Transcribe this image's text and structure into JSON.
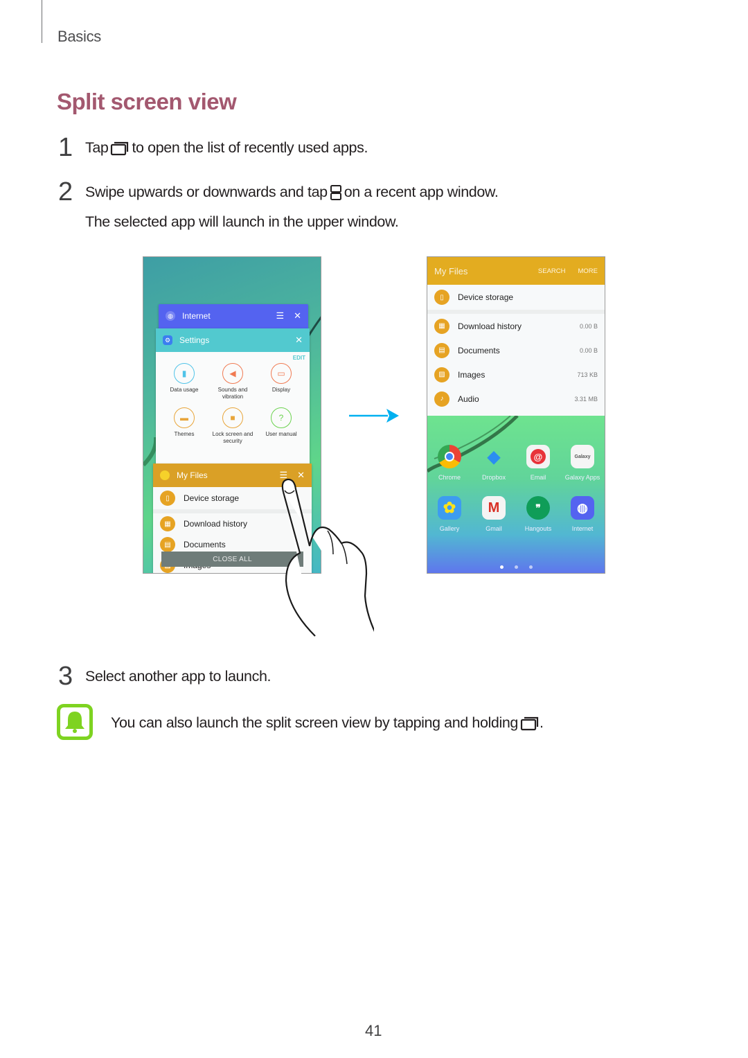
{
  "header": {
    "section": "Basics",
    "title": "Split screen view"
  },
  "steps": [
    {
      "number": "1",
      "text_before": "Tap",
      "icon": "recent-apps-icon",
      "text_after": "to open the list of recently used apps."
    },
    {
      "number": "2",
      "text_before": "Swipe upwards or downwards and tap",
      "icon": "split-screen-icon",
      "text_after": "on a recent app window.",
      "subtext": "The selected app will launch in the upper window."
    },
    {
      "number": "3",
      "text": "Select another app to launch."
    }
  ],
  "note": {
    "icon": "bell-notice-icon",
    "text": "You can also launch the split screen view by tapping and holding",
    "icon_after": "recent-apps-icon",
    "suffix": "."
  },
  "left_screen": {
    "cards": {
      "internet": {
        "title": "Internet",
        "color": "#5463f0"
      },
      "settings": {
        "title": "Settings",
        "color": "#52c9cf",
        "edit_label": "EDIT",
        "items": [
          {
            "label": "Data usage",
            "icon": "data-usage-icon",
            "color": "#4fc3e8"
          },
          {
            "label": "Sounds and vibration",
            "icon": "sound-icon",
            "color": "#f07a52"
          },
          {
            "label": "Display",
            "icon": "display-icon",
            "color": "#f07a52"
          },
          {
            "label": "Themes",
            "icon": "themes-icon",
            "color": "#e8a53a"
          },
          {
            "label": "Lock screen and security",
            "icon": "lock-icon",
            "color": "#e8a53a"
          },
          {
            "label": "User manual",
            "icon": "user-manual-icon",
            "color": "#6bd24f"
          }
        ]
      },
      "myfiles": {
        "title": "My Files",
        "color": "#daa026",
        "rows": [
          "Device storage",
          "Download history",
          "Documents",
          "Images"
        ]
      }
    },
    "close_all": "CLOSE ALL"
  },
  "right_screen": {
    "app_bar": {
      "title": "My Files",
      "actions": [
        "SEARCH",
        "MORE"
      ],
      "color": "#e3ac20"
    },
    "files": [
      {
        "name": "Device storage",
        "size": ""
      },
      {
        "name": "Download history",
        "size": "0.00 B"
      },
      {
        "name": "Documents",
        "size": "0.00 B"
      },
      {
        "name": "Images",
        "size": "713 KB"
      },
      {
        "name": "Audio",
        "size": "3.31 MB"
      }
    ],
    "apps": [
      {
        "label": "Chrome"
      },
      {
        "label": "Dropbox"
      },
      {
        "label": "Email"
      },
      {
        "label": "Galaxy Apps"
      },
      {
        "label": "Gallery"
      },
      {
        "label": "Gmail"
      },
      {
        "label": "Hangouts"
      },
      {
        "label": "Internet"
      }
    ],
    "page_indicator": {
      "pages": 3,
      "current": 1
    }
  },
  "arrow_color": "#00b0f0",
  "page_number": "41"
}
